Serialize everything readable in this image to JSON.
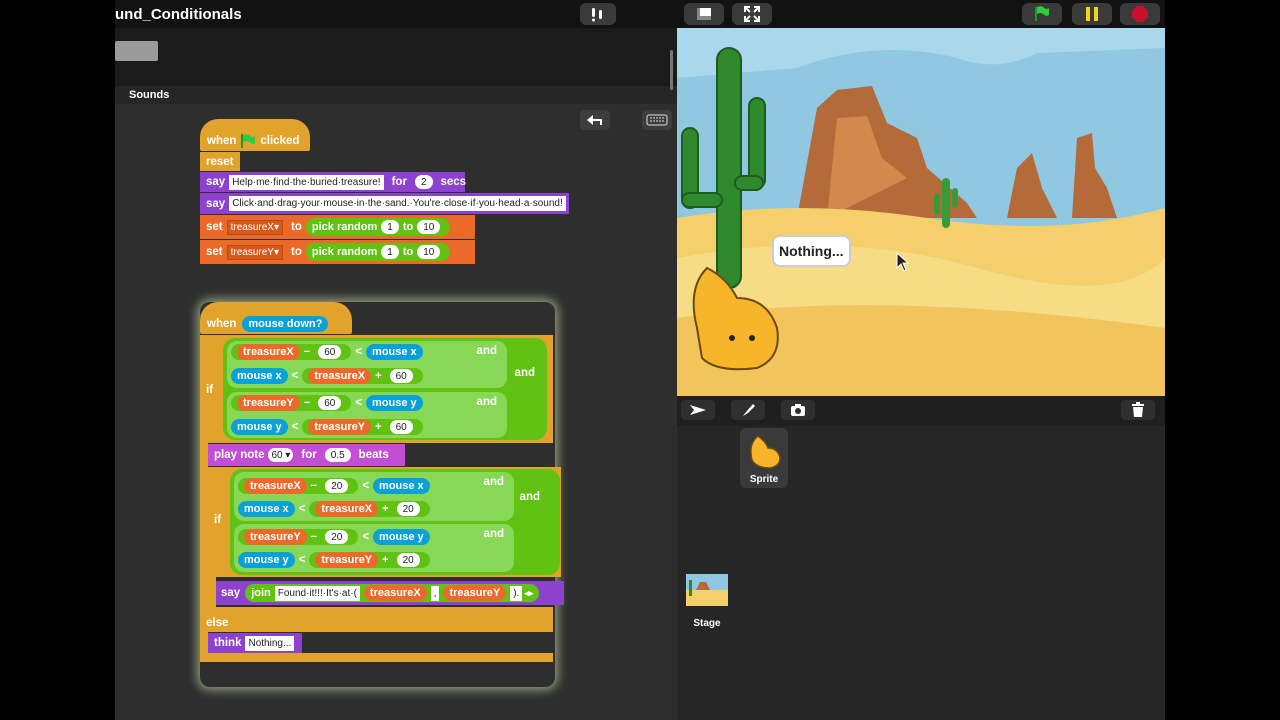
{
  "project": {
    "title": "und_Conditionals"
  },
  "tabs": {
    "sounds": "Sounds"
  },
  "script1": {
    "hat_when": "when",
    "hat_clicked": "clicked",
    "reset": "reset",
    "say1": {
      "verb": "say",
      "text": "Help·me·find·the·buried·treasure!",
      "for": "for",
      "secs_value": "2",
      "secs": "secs"
    },
    "say2": {
      "verb": "say",
      "text": "Click·and·drag·your·mouse·in·the·sand.·You're·close·if·you·head·a·sound!"
    },
    "setX": {
      "verb": "set",
      "var": "treasureX",
      "to": "to",
      "op": "pick random",
      "from": "1",
      "conj": "to",
      "upto": "10"
    },
    "setY": {
      "verb": "set",
      "var": "treasureY",
      "to": "to",
      "op": "pick random",
      "from": "1",
      "conj": "to",
      "upto": "10"
    }
  },
  "script2": {
    "hat_when": "when",
    "hat_pred": "mouse down?",
    "if_label": "if",
    "and_label": "and",
    "cond1": [
      {
        "a": "treasureX",
        "op": "−",
        "n": "60",
        "cmp": "<",
        "b": "mouse x"
      },
      {
        "a": "mouse x",
        "cmp": "<",
        "b": "treasureX",
        "op": "+",
        "n": "60"
      },
      {
        "a": "treasureY",
        "op": "−",
        "n": "60",
        "cmp": "<",
        "b": "mouse y"
      },
      {
        "a": "mouse y",
        "cmp": "<",
        "b": "treasureY",
        "op": "+",
        "n": "60"
      }
    ],
    "play": {
      "verb": "play note",
      "note": "60",
      "for": "for",
      "beats_value": "0.5",
      "beats": "beats"
    },
    "cond2": [
      {
        "a": "treasureX",
        "op": "−",
        "n": "20",
        "cmp": "<",
        "b": "mouse x"
      },
      {
        "a": "mouse x",
        "cmp": "<",
        "b": "treasureX",
        "op": "+",
        "n": "20"
      },
      {
        "a": "treasureY",
        "op": "−",
        "n": "20",
        "cmp": "<",
        "b": "mouse y"
      },
      {
        "a": "mouse y",
        "cmp": "<",
        "b": "treasureY",
        "op": "+",
        "n": "20"
      }
    ],
    "say_join": {
      "verb": "say",
      "join": "join",
      "text1": "Found·it!!!·It's·at·(",
      "v1": "treasureX",
      "comma": ",",
      "v2": "treasureY",
      "close": ")."
    },
    "else": "else",
    "think": {
      "verb": "think",
      "text": "Nothing..."
    }
  },
  "stage": {
    "bubble": "Nothing..."
  },
  "corral": {
    "sprite_label": "Sprite",
    "stage_label": "Stage"
  },
  "colors": {
    "control": "#e1a32b",
    "looks": "#8d42ce",
    "sound": "#c04fd4",
    "variables": "#eb6a2a",
    "operators": "#62c213",
    "sensing": "#0aa1d8"
  }
}
